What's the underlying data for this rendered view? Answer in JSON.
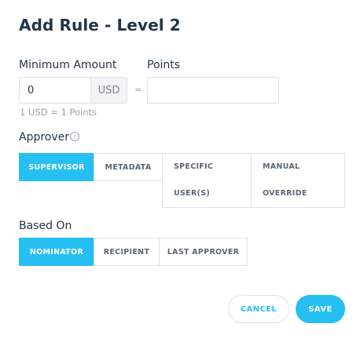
{
  "dialog": {
    "title": "Add Rule - Level 2",
    "cancel_label": "CANCEL",
    "save_label": "SAVE"
  },
  "amount": {
    "label": "Minimum Amount",
    "value": "0",
    "unit": "USD",
    "equals": "=",
    "conversion_hint": "1 USD = 1 Points"
  },
  "points": {
    "label": "Points",
    "value": ""
  },
  "approver": {
    "label": "Approver",
    "info_icon": "info-icon",
    "options": [
      {
        "label": "SUPERVISOR",
        "active": true
      },
      {
        "label": "METADATA",
        "active": false
      },
      {
        "label_line1": "SPECIFIC",
        "label_line2": "USER(S)",
        "active": false
      },
      {
        "label_line1": "MANUAL",
        "label_line2": "OVERRIDE",
        "active": false
      }
    ]
  },
  "based_on": {
    "label": "Based On",
    "options": [
      {
        "label": "NOMINATOR",
        "active": true
      },
      {
        "label": "RECIPIENT",
        "active": false
      },
      {
        "label": "LAST APPROVER",
        "active": false
      }
    ]
  },
  "colors": {
    "accent": "#26bff2",
    "text": "#243447",
    "muted": "#9aa3ac",
    "border": "#dde2e7"
  }
}
